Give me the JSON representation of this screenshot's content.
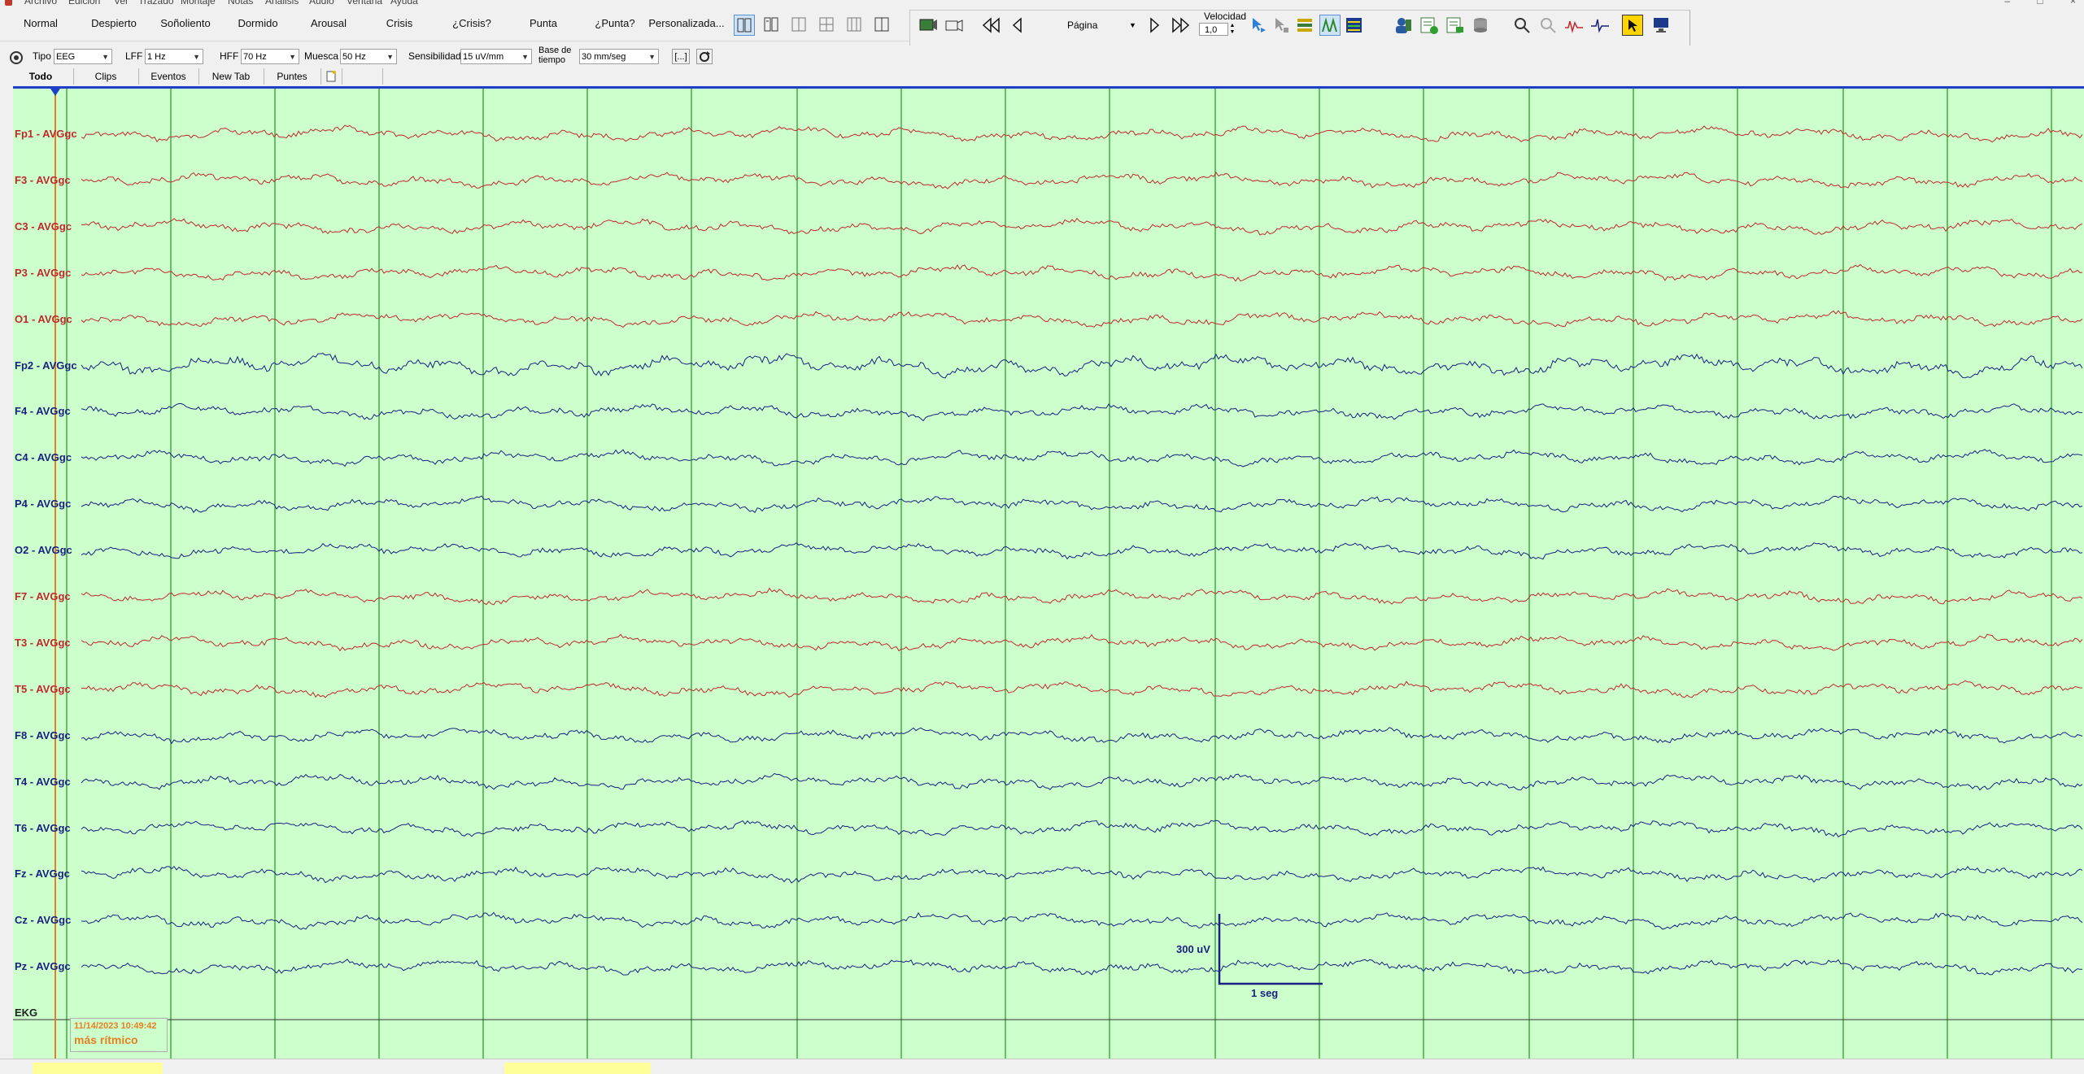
{
  "menu": {
    "items": [
      "Archivo",
      "Edición",
      "Ver",
      "Trazado",
      "Montaje",
      "Notas",
      "Análisis",
      "Audio",
      "Ventana",
      "Ayuda"
    ]
  },
  "state_buttons": [
    "Normal",
    "Despierto",
    "Soñoliento",
    "Dormido",
    "Arousal",
    "Crisis",
    "¿Crisis?",
    "Punta",
    "¿Punta?",
    "Personalizada..."
  ],
  "toolbar": {
    "page_label": "Página",
    "speed_label": "Velocidad",
    "speed_value": "1,0"
  },
  "filters": {
    "tipo_label": "Tipo",
    "tipo_value": "EEG",
    "lff_label": "LFF",
    "lff_value": "1 Hz",
    "hff_label": "HFF",
    "hff_value": "70 Hz",
    "muesca_label": "Muesca",
    "muesca_value": "50 Hz",
    "sens_label": "Sensibilidad",
    "sens_value": "15 uV/mm",
    "base_label_1": "Base de",
    "base_label_2": "tiempo",
    "base_value": "30 mm/seg",
    "bracket_button": "[...]"
  },
  "tabs": [
    "Todo",
    "Clips",
    "Eventos",
    "New Tab",
    "Puntes"
  ],
  "active_tab": "Todo",
  "channels": [
    {
      "label": "Fp1 - AVGgc",
      "color": "red"
    },
    {
      "label": "F3 - AVGgc",
      "color": "red"
    },
    {
      "label": "C3 - AVGgc",
      "color": "red"
    },
    {
      "label": "P3 - AVGgc",
      "color": "red"
    },
    {
      "label": "O1 - AVGgc",
      "color": "red"
    },
    {
      "label": "Fp2 - AVGgc",
      "color": "blue"
    },
    {
      "label": "F4 - AVGgc",
      "color": "blue"
    },
    {
      "label": "C4 - AVGgc",
      "color": "blue"
    },
    {
      "label": "P4 - AVGgc",
      "color": "blue"
    },
    {
      "label": "O2 - AVGgc",
      "color": "blue"
    },
    {
      "label": "F7 - AVGgc",
      "color": "red"
    },
    {
      "label": "T3 - AVGgc",
      "color": "red"
    },
    {
      "label": "T5 - AVGgc",
      "color": "red"
    },
    {
      "label": "F8 - AVGgc",
      "color": "blue"
    },
    {
      "label": "T4 - AVGgc",
      "color": "blue"
    },
    {
      "label": "T6 - AVGgc",
      "color": "blue"
    },
    {
      "label": "Fz - AVGgc",
      "color": "blue"
    },
    {
      "label": "Cz - AVGgc",
      "color": "blue"
    },
    {
      "label": "Pz - AVGgc",
      "color": "blue"
    },
    {
      "label": "EKG",
      "color": "black"
    }
  ],
  "colors": {
    "trace_red": "#c0282d",
    "trace_blue": "#1a1f80",
    "trace_black": "#222222",
    "grid_green": "#2e9e2e",
    "background": "#ccffcc",
    "cursor_orange": "#e67e22",
    "header_blue": "#1f3fc6"
  },
  "marker": {
    "timestamp": "11/14/2023 10:49:42",
    "note": "más rítmico"
  },
  "calibration": {
    "amplitude_label": "300 uV",
    "time_label": "1 seg"
  }
}
